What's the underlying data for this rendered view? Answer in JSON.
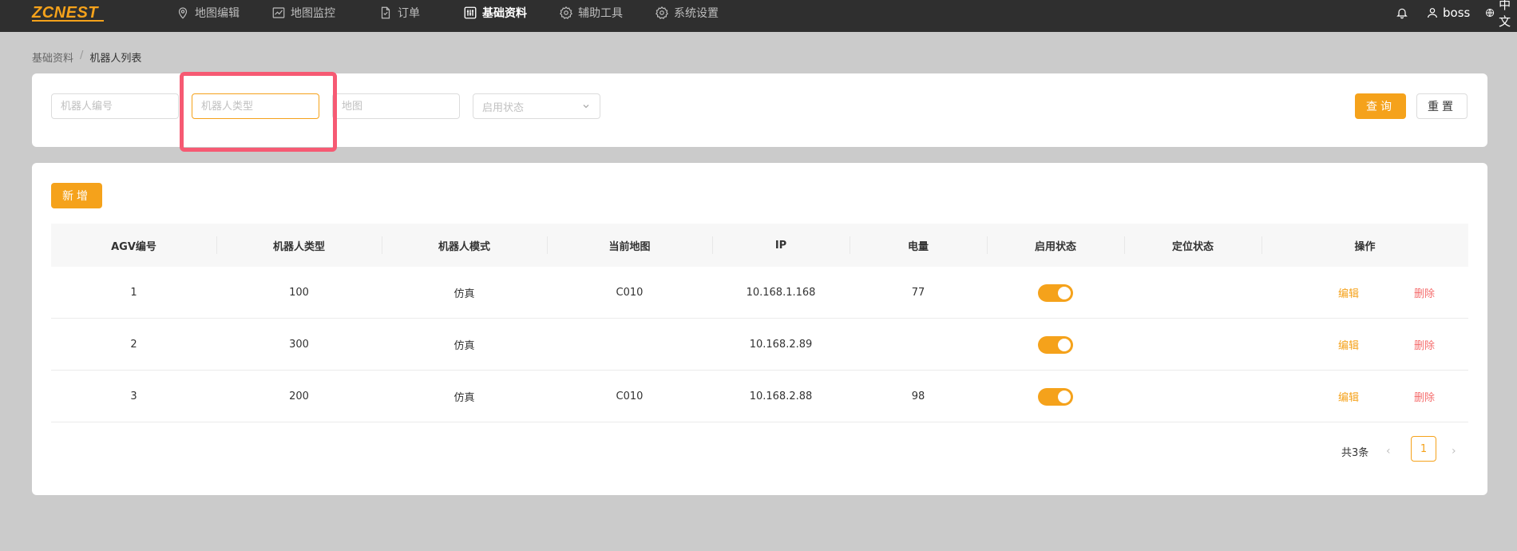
{
  "app": {
    "logo": "ZCNEST"
  },
  "nav": {
    "items": [
      {
        "label": "地图编辑",
        "icon": "map-pin-icon"
      },
      {
        "label": "地图监控",
        "icon": "chart-monitor-icon"
      },
      {
        "label": "订单",
        "icon": "document-icon"
      },
      {
        "label": "基础资料",
        "icon": "sliders-icon"
      },
      {
        "label": "辅助工具",
        "icon": "gear-icon"
      },
      {
        "label": "系统设置",
        "icon": "gear-icon"
      }
    ],
    "active_index": 3,
    "user": "boss",
    "language": "中文"
  },
  "breadcrumb": {
    "root": "基础资料",
    "separator": "/",
    "current": "机器人列表"
  },
  "filters": {
    "robot_no_placeholder": "机器人编号",
    "robot_type_placeholder": "机器人类型",
    "map_placeholder": "地图",
    "enable_status_placeholder": "启用状态",
    "query_label": "查询",
    "reset_label": "重置"
  },
  "toolbar": {
    "add_label": "新增"
  },
  "table": {
    "columns": [
      "AGV编号",
      "机器人类型",
      "机器人模式",
      "当前地图",
      "IP",
      "电量",
      "启用状态",
      "定位状态",
      "操作"
    ],
    "rows": [
      {
        "agv_no": "1",
        "robot_type": "100",
        "mode": "仿真",
        "map": "C010",
        "ip": "10.168.1.168",
        "battery": "77",
        "enabled": true,
        "location": ""
      },
      {
        "agv_no": "2",
        "robot_type": "300",
        "mode": "仿真",
        "map": "",
        "ip": "10.168.2.89",
        "battery": "",
        "enabled": true,
        "location": ""
      },
      {
        "agv_no": "3",
        "robot_type": "200",
        "mode": "仿真",
        "map": "C010",
        "ip": "10.168.2.88",
        "battery": "98",
        "enabled": true,
        "location": ""
      }
    ],
    "edit_label": "编辑",
    "delete_label": "删除"
  },
  "pagination": {
    "total_text": "共3条",
    "current_page": "1"
  },
  "colors": {
    "accent": "#f5a21b",
    "danger": "#f56c6c",
    "highlight": "#f65a73"
  }
}
